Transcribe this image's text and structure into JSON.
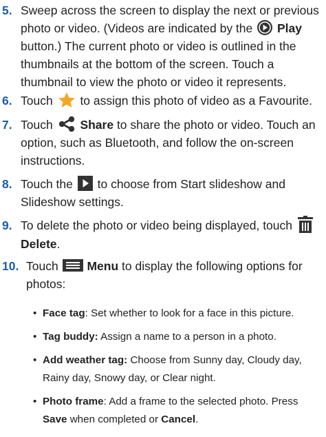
{
  "steps": {
    "s5": {
      "num": "5.",
      "t1": "Sweep across the screen to display the next or previous photo or video. (Videos are indicated by the ",
      "bold": "Play",
      "t2": " button.) The current photo or video is outlined in the thumbnails at the bottom of the screen. Touch a thumbnail to view the photo or video it represents."
    },
    "s6": {
      "num": "6.",
      "t1": "Touch ",
      "t2": " to assign this photo of video as a Favourite."
    },
    "s7": {
      "num": "7.",
      "t1": "Touch ",
      "bold": "Share",
      "t2": " to share the photo or video. Touch an option, such as Bluetooth, and follow the on-screen instructions."
    },
    "s8": {
      "num": "8.",
      "t1": "Touch the ",
      "t2": " to choose from Start slideshow and Slideshow settings."
    },
    "s9": {
      "num": "9.",
      "t1": "To delete the photo or video being displayed, touch ",
      "bold": "Delete",
      "t2": "."
    },
    "s10": {
      "num": "10.",
      "t1": "Touch ",
      "bold": "Menu",
      "t2": " to display the following options for photos:"
    }
  },
  "bullets": [
    {
      "dot": "•",
      "term": "Face tag",
      "text": ": Set whether to look for a face in this picture."
    },
    {
      "dot": "•",
      "term": "Tag buddy:",
      "text": " Assign a name to a person in a photo."
    },
    {
      "dot": "•",
      "term": "Add weather tag:",
      "text": " Choose from Sunny day, Cloudy day, Rainy day, Snowy day, or Clear night."
    },
    {
      "dot": "•",
      "term": "Photo frame",
      "text": ": Add a frame to the selected photo. Press ",
      "b2": "Save",
      "t3": " when completed or ",
      "b3": "Cancel",
      "t4": "."
    }
  ],
  "icons": {
    "play": "play-circle-icon",
    "favourite": "star-icon",
    "share": "share-icon",
    "slideshow": "play-square-icon",
    "delete": "trash-icon",
    "menu": "menu-icon"
  },
  "colors": {
    "number": "#1b5ea8",
    "star": "#f5a623",
    "icon_dark": "#333333",
    "text": "#222222"
  }
}
